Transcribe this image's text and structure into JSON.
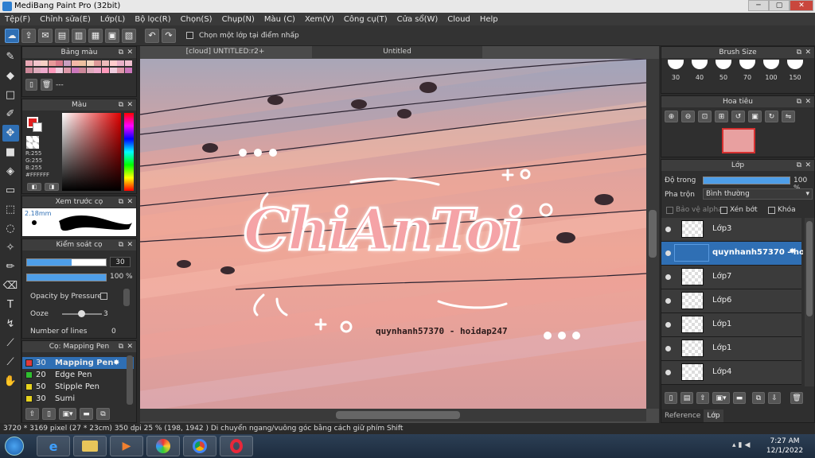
{
  "window": {
    "title": "MediBang Paint Pro (32bit)",
    "min": "─",
    "max": "▢",
    "close": "✕"
  },
  "menu": [
    "Tệp(F)",
    "Chỉnh sửa(E)",
    "Lớp(L)",
    "Bộ lọc(R)",
    "Chọn(S)",
    "Chụp(N)",
    "Màu (C)",
    "Xem(V)",
    "Công cụ(T)",
    "Cửa sổ(W)",
    "Cloud",
    "Help"
  ],
  "toolbar": {
    "sample_layer_label": "Chọn một lớp tại điểm nhấp"
  },
  "palette_panel": {
    "title": "Bảng màu",
    "placeholder": "---"
  },
  "color_panel": {
    "title": "Màu",
    "r": "R:255",
    "g": "G:255",
    "b": "B:255",
    "hex": "#FFFFFF"
  },
  "preview_panel": {
    "title": "Xem trước cọ",
    "size": "2.18mm"
  },
  "control_panel": {
    "title": "Kiểm soát cọ",
    "size_value": "30",
    "opacity_value": "100 %",
    "opacity_pressure": "Opacity by Pressure",
    "ooze_label": "Ooze",
    "ooze_value": "3",
    "lines_label": "Number of lines",
    "lines_value": "0"
  },
  "brush_panel": {
    "title": "Cọ: Mapping Pen",
    "items": [
      {
        "size": "30",
        "name": "Mapping Pen",
        "color": "#e03a3a"
      },
      {
        "size": "20",
        "name": "Edge Pen",
        "color": "#2fbf2f"
      },
      {
        "size": "50",
        "name": "Stipple Pen",
        "color": "#e6d21d"
      },
      {
        "size": "30",
        "name": "Sumi",
        "color": "#e6d21d"
      }
    ]
  },
  "canvas": {
    "tab_active": "[cloud] UNTITLED:r2+",
    "tab_other": "Untitled",
    "art_title": "ChiAnToi",
    "art_credit": "quynhanh57370 - hoidap247"
  },
  "brush_size_panel": {
    "title": "Brush Size",
    "sizes": [
      "30",
      "40",
      "50",
      "70",
      "100",
      "150"
    ]
  },
  "navigator_panel": {
    "title": "Hoa tiêu"
  },
  "layer_panel": {
    "title": "Lớp",
    "opacity_label": "Độ trong",
    "opacity_value": "100 %",
    "blend_label": "Pha trộn",
    "blend_value": "Bình thường",
    "protect_alpha": "Bảo vệ alpha",
    "clipping": "Xén bớt",
    "lock": "Khóa",
    "layers": [
      "Lớp3",
      "quynhanh57370 - ho",
      "Lớp7",
      "Lớp6",
      "Lớp1",
      "Lớp1",
      "Lớp4"
    ],
    "tabs": [
      "Reference",
      "Lớp"
    ]
  },
  "statusbar": {
    "text": "3720 * 3169 pixel  (27 * 23cm)  350 dpi  25 %  (198, 1942 )  Di chuyển ngang/vuông góc bằng cách giữ phím Shift"
  },
  "taskbar": {
    "time": "7:27 AM",
    "date": "12/1/2022"
  }
}
